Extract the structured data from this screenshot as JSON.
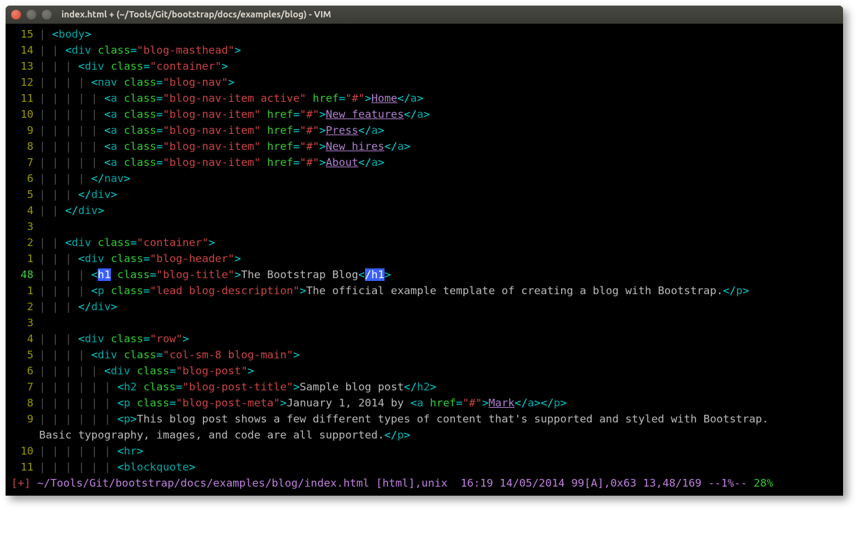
{
  "window": {
    "title": "index.html + (~/Tools/Git/bootstrap/docs/examples/blog) - VIM"
  },
  "gutter": [
    "15",
    "14",
    "13",
    "12",
    "11",
    "10",
    "9",
    "8",
    "7",
    "6",
    "5",
    "4",
    "3",
    "2",
    "1",
    "48",
    "1",
    "2",
    "3",
    "4",
    "5",
    "6",
    "7",
    "8",
    "9",
    "",
    "10",
    "11"
  ],
  "lines": [
    {
      "i": "| ",
      "t": [
        [
          "br",
          "<"
        ],
        [
          "tag",
          "body"
        ],
        [
          "br",
          ">"
        ]
      ]
    },
    {
      "i": "| | ",
      "t": [
        [
          "br",
          "<"
        ],
        [
          "tag",
          "div"
        ],
        [
          "txt",
          " "
        ],
        [
          "attr",
          "class"
        ],
        [
          "eq",
          "="
        ],
        [
          "str",
          "\"blog-masthead\""
        ],
        [
          "br",
          ">"
        ]
      ]
    },
    {
      "i": "| | | ",
      "t": [
        [
          "br",
          "<"
        ],
        [
          "tag",
          "div"
        ],
        [
          "txt",
          " "
        ],
        [
          "attr",
          "class"
        ],
        [
          "eq",
          "="
        ],
        [
          "str",
          "\"container\""
        ],
        [
          "br",
          ">"
        ]
      ]
    },
    {
      "i": "| | | | ",
      "t": [
        [
          "br",
          "<"
        ],
        [
          "tag",
          "nav"
        ],
        [
          "txt",
          " "
        ],
        [
          "attr",
          "class"
        ],
        [
          "eq",
          "="
        ],
        [
          "str",
          "\"blog-nav\""
        ],
        [
          "br",
          ">"
        ]
      ]
    },
    {
      "i": "| | | | | ",
      "t": [
        [
          "br",
          "<"
        ],
        [
          "tag",
          "a"
        ],
        [
          "txt",
          " "
        ],
        [
          "attr",
          "class"
        ],
        [
          "eq",
          "="
        ],
        [
          "str",
          "\"blog-nav-item active\""
        ],
        [
          "txt",
          " "
        ],
        [
          "attr",
          "href"
        ],
        [
          "eq",
          "="
        ],
        [
          "str",
          "\"#\""
        ],
        [
          "br",
          ">"
        ],
        [
          "lnk",
          "Home"
        ],
        [
          "br",
          "</"
        ],
        [
          "tag",
          "a"
        ],
        [
          "br",
          ">"
        ]
      ]
    },
    {
      "i": "| | | | | ",
      "t": [
        [
          "br",
          "<"
        ],
        [
          "tag",
          "a"
        ],
        [
          "txt",
          " "
        ],
        [
          "attr",
          "class"
        ],
        [
          "eq",
          "="
        ],
        [
          "str",
          "\"blog-nav-item\""
        ],
        [
          "txt",
          " "
        ],
        [
          "attr",
          "href"
        ],
        [
          "eq",
          "="
        ],
        [
          "str",
          "\"#\""
        ],
        [
          "br",
          ">"
        ],
        [
          "lnk",
          "New features"
        ],
        [
          "br",
          "</"
        ],
        [
          "tag",
          "a"
        ],
        [
          "br",
          ">"
        ]
      ]
    },
    {
      "i": "| | | | | ",
      "t": [
        [
          "br",
          "<"
        ],
        [
          "tag",
          "a"
        ],
        [
          "txt",
          " "
        ],
        [
          "attr",
          "class"
        ],
        [
          "eq",
          "="
        ],
        [
          "str",
          "\"blog-nav-item\""
        ],
        [
          "txt",
          " "
        ],
        [
          "attr",
          "href"
        ],
        [
          "eq",
          "="
        ],
        [
          "str",
          "\"#\""
        ],
        [
          "br",
          ">"
        ],
        [
          "lnk",
          "Press"
        ],
        [
          "br",
          "</"
        ],
        [
          "tag",
          "a"
        ],
        [
          "br",
          ">"
        ]
      ]
    },
    {
      "i": "| | | | | ",
      "t": [
        [
          "br",
          "<"
        ],
        [
          "tag",
          "a"
        ],
        [
          "txt",
          " "
        ],
        [
          "attr",
          "class"
        ],
        [
          "eq",
          "="
        ],
        [
          "str",
          "\"blog-nav-item\""
        ],
        [
          "txt",
          " "
        ],
        [
          "attr",
          "href"
        ],
        [
          "eq",
          "="
        ],
        [
          "str",
          "\"#\""
        ],
        [
          "br",
          ">"
        ],
        [
          "lnk",
          "New hires"
        ],
        [
          "br",
          "</"
        ],
        [
          "tag",
          "a"
        ],
        [
          "br",
          ">"
        ]
      ]
    },
    {
      "i": "| | | | | ",
      "t": [
        [
          "br",
          "<"
        ],
        [
          "tag",
          "a"
        ],
        [
          "txt",
          " "
        ],
        [
          "attr",
          "class"
        ],
        [
          "eq",
          "="
        ],
        [
          "str",
          "\"blog-nav-item\""
        ],
        [
          "txt",
          " "
        ],
        [
          "attr",
          "href"
        ],
        [
          "eq",
          "="
        ],
        [
          "str",
          "\"#\""
        ],
        [
          "br",
          ">"
        ],
        [
          "lnk",
          "About"
        ],
        [
          "br",
          "</"
        ],
        [
          "tag",
          "a"
        ],
        [
          "br",
          ">"
        ]
      ]
    },
    {
      "i": "| | | | ",
      "t": [
        [
          "br",
          "</"
        ],
        [
          "tag",
          "nav"
        ],
        [
          "br",
          ">"
        ]
      ]
    },
    {
      "i": "| | | ",
      "t": [
        [
          "br",
          "</"
        ],
        [
          "tag",
          "div"
        ],
        [
          "br",
          ">"
        ]
      ]
    },
    {
      "i": "| | ",
      "t": [
        [
          "br",
          "</"
        ],
        [
          "tag",
          "div"
        ],
        [
          "br",
          ">"
        ]
      ]
    },
    {
      "i": "",
      "t": []
    },
    {
      "i": "| | ",
      "t": [
        [
          "br",
          "<"
        ],
        [
          "tag",
          "div"
        ],
        [
          "txt",
          " "
        ],
        [
          "attr",
          "class"
        ],
        [
          "eq",
          "="
        ],
        [
          "str",
          "\"container\""
        ],
        [
          "br",
          ">"
        ]
      ]
    },
    {
      "i": "| | | ",
      "t": [
        [
          "br",
          "<"
        ],
        [
          "tag",
          "div"
        ],
        [
          "txt",
          " "
        ],
        [
          "attr",
          "class"
        ],
        [
          "eq",
          "="
        ],
        [
          "str",
          "\"blog-header\""
        ],
        [
          "br",
          ">"
        ]
      ]
    },
    {
      "i": "| | | | ",
      "t": [
        [
          "br",
          "<"
        ],
        [
          "hl",
          "h1"
        ],
        [
          "txt",
          " "
        ],
        [
          "attr",
          "class"
        ],
        [
          "eq",
          "="
        ],
        [
          "str",
          "\"blog-title\""
        ],
        [
          "br",
          ">"
        ],
        [
          "txt",
          "The Bootstrap Blog"
        ],
        [
          "br",
          "<"
        ],
        [
          "hl",
          "/h1"
        ],
        [
          "br",
          ">"
        ]
      ]
    },
    {
      "i": "| | | | ",
      "t": [
        [
          "br",
          "<"
        ],
        [
          "tag",
          "p"
        ],
        [
          "txt",
          " "
        ],
        [
          "attr",
          "class"
        ],
        [
          "eq",
          "="
        ],
        [
          "str",
          "\"lead blog-description\""
        ],
        [
          "br",
          ">"
        ],
        [
          "txt",
          "The official example template of creating a blog with Bootstrap."
        ],
        [
          "br",
          "</"
        ],
        [
          "tag",
          "p"
        ],
        [
          "br",
          ">"
        ]
      ]
    },
    {
      "i": "| | | ",
      "t": [
        [
          "br",
          "</"
        ],
        [
          "tag",
          "div"
        ],
        [
          "br",
          ">"
        ]
      ]
    },
    {
      "i": "",
      "t": []
    },
    {
      "i": "| | | ",
      "t": [
        [
          "br",
          "<"
        ],
        [
          "tag",
          "div"
        ],
        [
          "txt",
          " "
        ],
        [
          "attr",
          "class"
        ],
        [
          "eq",
          "="
        ],
        [
          "str",
          "\"row\""
        ],
        [
          "br",
          ">"
        ]
      ]
    },
    {
      "i": "| | | | ",
      "t": [
        [
          "br",
          "<"
        ],
        [
          "tag",
          "div"
        ],
        [
          "txt",
          " "
        ],
        [
          "attr",
          "class"
        ],
        [
          "eq",
          "="
        ],
        [
          "str",
          "\"col-sm-8 blog-main\""
        ],
        [
          "br",
          ">"
        ]
      ]
    },
    {
      "i": "| | | | | ",
      "t": [
        [
          "br",
          "<"
        ],
        [
          "tag",
          "div"
        ],
        [
          "txt",
          " "
        ],
        [
          "attr",
          "class"
        ],
        [
          "eq",
          "="
        ],
        [
          "str",
          "\"blog-post\""
        ],
        [
          "br",
          ">"
        ]
      ]
    },
    {
      "i": "| | | | | | ",
      "t": [
        [
          "br",
          "<"
        ],
        [
          "tag",
          "h2"
        ],
        [
          "txt",
          " "
        ],
        [
          "attr",
          "class"
        ],
        [
          "eq",
          "="
        ],
        [
          "str",
          "\"blog-post-title\""
        ],
        [
          "br",
          ">"
        ],
        [
          "txt",
          "Sample blog post"
        ],
        [
          "br",
          "</"
        ],
        [
          "tag",
          "h2"
        ],
        [
          "br",
          ">"
        ]
      ]
    },
    {
      "i": "| | | | | | ",
      "t": [
        [
          "br",
          "<"
        ],
        [
          "tag",
          "p"
        ],
        [
          "txt",
          " "
        ],
        [
          "attr",
          "class"
        ],
        [
          "eq",
          "="
        ],
        [
          "str",
          "\"blog-post-meta\""
        ],
        [
          "br",
          ">"
        ],
        [
          "txt",
          "January 1, 2014 by "
        ],
        [
          "br",
          "<"
        ],
        [
          "tag",
          "a"
        ],
        [
          "txt",
          " "
        ],
        [
          "attr",
          "href"
        ],
        [
          "eq",
          "="
        ],
        [
          "str",
          "\"#\""
        ],
        [
          "br",
          ">"
        ],
        [
          "lnk",
          "Mark"
        ],
        [
          "br",
          "</"
        ],
        [
          "tag",
          "a"
        ],
        [
          "br",
          ">"
        ],
        [
          "br",
          "</"
        ],
        [
          "tag",
          "p"
        ],
        [
          "br",
          ">"
        ]
      ]
    },
    {
      "i": "| | | | | | ",
      "t": [
        [
          "br",
          "<"
        ],
        [
          "tag",
          "p"
        ],
        [
          "br",
          ">"
        ],
        [
          "txt",
          "This blog post shows a few different types of content that's supported and styled with Bootstrap."
        ]
      ]
    },
    {
      "i": "",
      "t": [
        [
          "txt",
          "Basic typography, images, and code are all supported."
        ],
        [
          "br",
          "</"
        ],
        [
          "tag",
          "p"
        ],
        [
          "br",
          ">"
        ]
      ]
    },
    {
      "i": "| | | | | | ",
      "t": [
        [
          "br",
          "<"
        ],
        [
          "tag",
          "hr"
        ],
        [
          "br",
          ">"
        ]
      ]
    },
    {
      "i": "| | | | | | ",
      "t": [
        [
          "br",
          "<"
        ],
        [
          "tag",
          "blockquote"
        ],
        [
          "br",
          ">"
        ]
      ]
    }
  ],
  "status": {
    "flag": "[+]",
    "path": "~/Tools/Git/bootstrap/docs/examples/blog/index.html",
    "ft": "[html],unix",
    "time": "16:19 14/05/2014",
    "misc": "99[A],0x63 13,48/169",
    "pct1": "--1%--",
    "pct2": "28%"
  }
}
